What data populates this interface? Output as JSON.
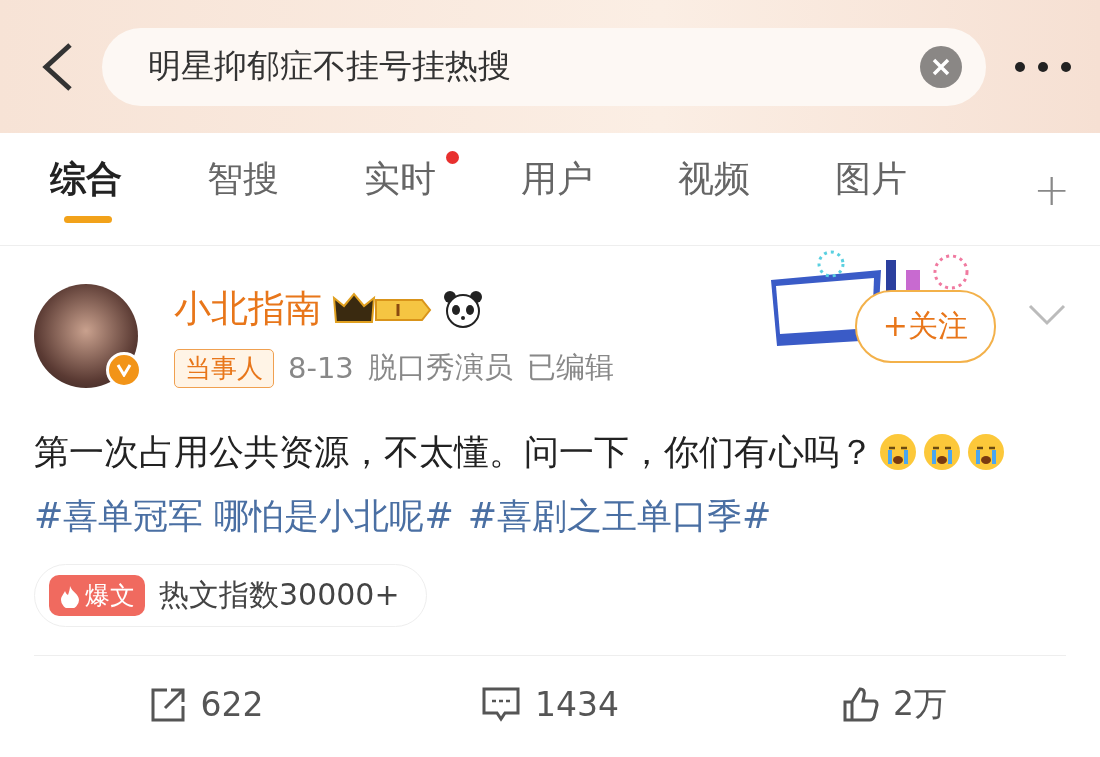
{
  "search": {
    "value": "明星抑郁症不挂号挂热搜"
  },
  "tabs": [
    {
      "label": "综合",
      "selected": true,
      "dot": false
    },
    {
      "label": "智搜",
      "selected": false,
      "dot": false
    },
    {
      "label": "实时",
      "selected": false,
      "dot": true
    },
    {
      "label": "用户",
      "selected": false,
      "dot": false
    },
    {
      "label": "视频",
      "selected": false,
      "dot": false
    },
    {
      "label": "图片",
      "selected": false,
      "dot": false
    }
  ],
  "tab_add": "+",
  "post": {
    "author": "小北指南",
    "verified": true,
    "tag": "当事人",
    "date": "8-13",
    "source": "脱口秀演员",
    "edited": "已编辑",
    "follow": "+关注",
    "body": [
      {
        "kind": "text",
        "text": "第一次占用公共资源，不太懂。问一下，你们有心吗？"
      },
      {
        "kind": "emoji"
      },
      {
        "kind": "emoji"
      },
      {
        "kind": "emoji"
      },
      {
        "kind": "topic",
        "text": "#喜单冠军 哪怕是小北呢#"
      },
      {
        "kind": "topic",
        "text": "#喜剧之王单口季#"
      }
    ],
    "hot_badge": "爆文",
    "hot_index": "热文指数30000+",
    "actions": [
      {
        "kind": "share",
        "count": "622"
      },
      {
        "kind": "comment",
        "count": "1434"
      },
      {
        "kind": "like",
        "count": "2万"
      }
    ]
  }
}
